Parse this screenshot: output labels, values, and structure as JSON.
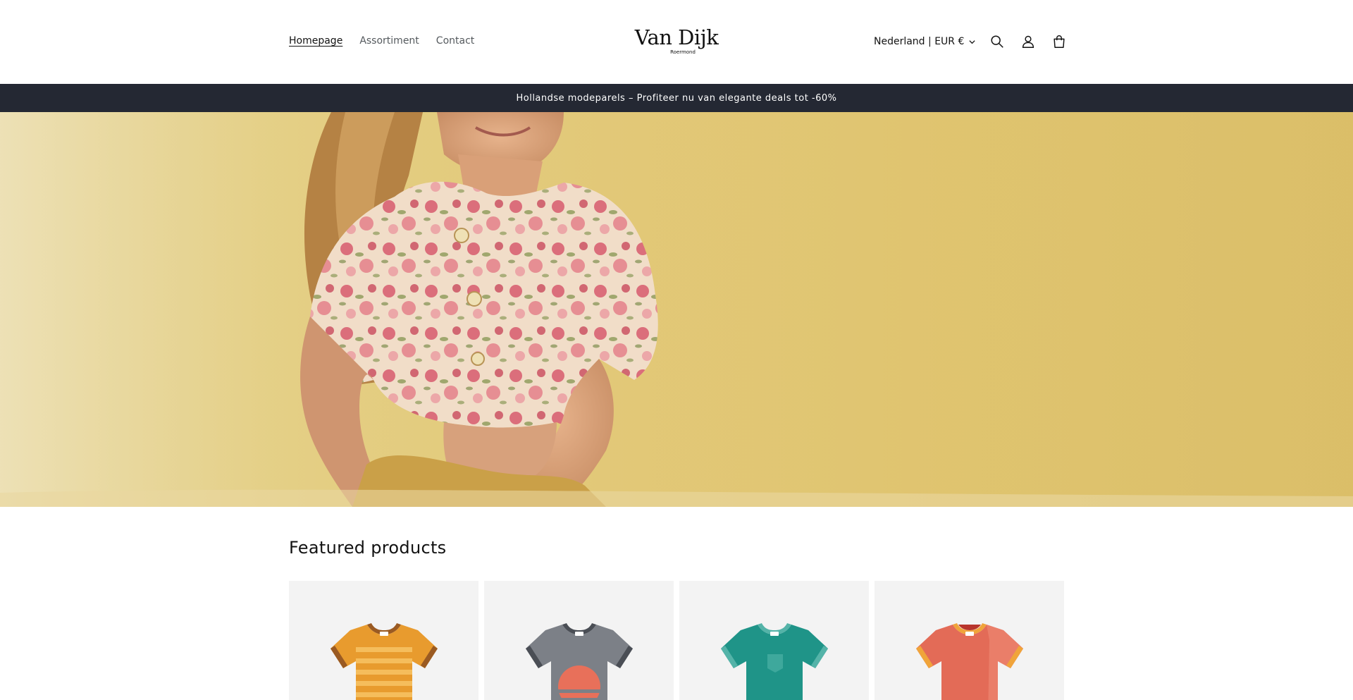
{
  "header": {
    "nav": [
      {
        "label": "Homepage",
        "active": true
      },
      {
        "label": "Assortiment",
        "active": false
      },
      {
        "label": "Contact",
        "active": false
      }
    ],
    "logo": {
      "name": "Van Dijk",
      "subtitle": "Roermond"
    },
    "locale": "Nederland | EUR €",
    "icons": [
      "search-icon",
      "account-icon",
      "cart-icon"
    ]
  },
  "announcement": "Hollandse modeparels – Profiteer nu van elegante deals tot -60%",
  "featured": {
    "title": "Featured products",
    "products": [
      {
        "icon": "tshirt-icon",
        "color": "#e89b2e",
        "trim": "#9a5a22",
        "pattern": "stripes"
      },
      {
        "icon": "tshirt-icon",
        "color": "#7c8087",
        "trim": "#4a4e55",
        "pattern": "sunset"
      },
      {
        "icon": "tshirt-icon",
        "color": "#1f9488",
        "trim": "#54b3a8",
        "pattern": "pocket"
      },
      {
        "icon": "tshirt-icon",
        "color": "#e36b57",
        "trim": "#f0a43a",
        "pattern": "plain"
      }
    ]
  },
  "colors": {
    "announcement_bg": "#242833",
    "hero_bg": "#e2c877"
  }
}
